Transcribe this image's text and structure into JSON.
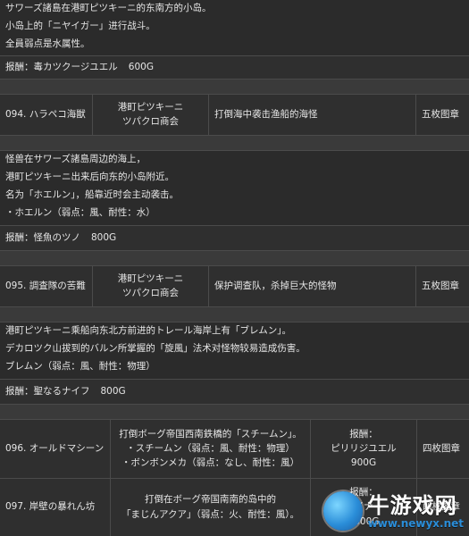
{
  "section1": {
    "desc_lines": [
      "サワーズ諸島在港町ピツキーニ的东南方的小岛。",
      "小岛上的「ニヤイガー」进行战斗。",
      "全員弱点是水属性。"
    ],
    "reward_label": "报酬：毒カツクージユエル",
    "reward_amount": "600G"
  },
  "quest094": {
    "no_title": "094. ハラペコ海獣",
    "client_line1": "港町ピツキーニ",
    "client_line2": "ツパクロ商会",
    "objective": "打倒海中袭击渔船的海怪",
    "rank": "五枚图章",
    "desc_lines": [
      "怪兽在サワーズ諸島周边的海上，",
      "港町ピツキーニ出来后向东的小岛附近。",
      "名为「ホエルン」，船靠近时会主动袭击。",
      "・ホエルン（弱点：風、耐性：水）"
    ],
    "reward_label": "报酬：怪魚のツノ",
    "reward_amount": "800G"
  },
  "quest095": {
    "no_title": "095. 調査隊の苦難",
    "client_line1": "港町ピツキーニ",
    "client_line2": "ツパクロ商会",
    "objective": "保护调查队，杀掉巨大的怪物",
    "rank": "五枚图章",
    "desc_lines": [
      "港町ピツキーニ乘船向东北方前进的トレール海岸上有「ブレムン」。",
      "デカロツク山拔到的バルン所掌握的「旋風」法术对怪物较易造成伤害。",
      "ブレムン（弱点：風、耐性：物理）"
    ],
    "reward_label": "报酬：聖なるナイフ",
    "reward_amount": "800G"
  },
  "quest096": {
    "no_title": "096. オールドマシーン",
    "detail_lines": [
      "打倒ボーグ帝国西南鉄橋的「スチームン」。",
      "・スチームン（弱点：風、耐性：物理）",
      "・ボンボンメカ（弱点：なし、耐性：風）"
    ],
    "reward_line1": "报酬：",
    "reward_line2": "ピリリジユエル",
    "reward_line3": "900G",
    "rank": "四枚图章"
  },
  "quest097": {
    "no_title": "097. 岸壁の暴れん坊",
    "detail_lines": [
      "打倒在ボーグ帝国南南的岛中的",
      "「まじんアクア」（弱点：火、耐性：風）。"
    ],
    "reward_line1": "报酬：",
    "reward_line2": "イナ",
    "reward_line3": "1000G",
    "rank": "四枚图章"
  },
  "watermark": {
    "title": "牛游戏网",
    "subtitle": "www.newyx.net"
  }
}
